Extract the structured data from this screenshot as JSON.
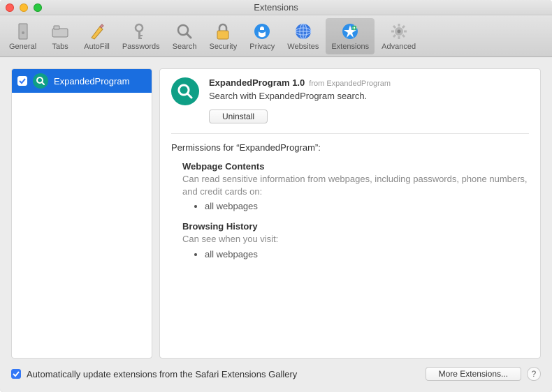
{
  "window": {
    "title": "Extensions"
  },
  "toolbar": {
    "items": [
      {
        "label": "General"
      },
      {
        "label": "Tabs"
      },
      {
        "label": "AutoFill"
      },
      {
        "label": "Passwords"
      },
      {
        "label": "Search"
      },
      {
        "label": "Security"
      },
      {
        "label": "Privacy"
      },
      {
        "label": "Websites"
      },
      {
        "label": "Extensions"
      },
      {
        "label": "Advanced"
      }
    ]
  },
  "sidebar": {
    "items": [
      {
        "name": "ExpandedProgram",
        "enabled": true,
        "selected": true
      }
    ]
  },
  "detail": {
    "name": "ExpandedProgram 1.0",
    "from": "from ExpandedProgram",
    "desc": "Search with ExpandedProgram search.",
    "uninstall_label": "Uninstall",
    "permissions_title": "Permissions for “ExpandedProgram”:",
    "sections": [
      {
        "heading": "Webpage Contents",
        "desc": "Can read sensitive information from webpages, including passwords, phone numbers, and credit cards on:",
        "items": [
          "all webpages"
        ]
      },
      {
        "heading": "Browsing History",
        "desc": "Can see when you visit:",
        "items": [
          "all webpages"
        ]
      }
    ]
  },
  "footer": {
    "auto_update_checked": true,
    "auto_update_label": "Automatically update extensions from the Safari Extensions Gallery",
    "more_label": "More Extensions...",
    "help_label": "?"
  },
  "colors": {
    "accent": "#1a6ee0",
    "icon_bg": "#0f9f86"
  }
}
